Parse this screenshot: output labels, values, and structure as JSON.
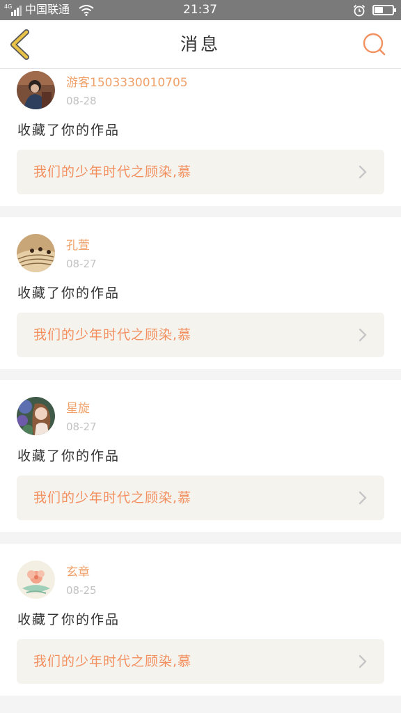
{
  "status_bar": {
    "network": "4G",
    "carrier": "中国联通",
    "time": "21:37",
    "icons": [
      "signal-icon",
      "wifi-icon",
      "alarm-icon",
      "battery-icon"
    ],
    "battery_level": 0.45
  },
  "header": {
    "title": "消息",
    "back_icon": "chevron-left-icon",
    "search_icon": "search-icon"
  },
  "colors": {
    "accent": "#f39060",
    "back_icon": "#e9c24a",
    "username": "#f0a068",
    "date": "#c2c2c2",
    "card_link_bg": "#f4f3ee",
    "page_bg": "#f4f4f4",
    "status_bar_bg": "#7a7a7a"
  },
  "messages": [
    {
      "username": "游客1503330010705",
      "date": "08-28",
      "action": "收藏了你的作品",
      "work_title": "我们的少年时代之顾染,慕",
      "link_icon": "chevron-right-icon"
    },
    {
      "username": "孔萱",
      "date": "08-27",
      "action": "收藏了你的作品",
      "work_title": "我们的少年时代之顾染,慕",
      "link_icon": "chevron-right-icon"
    },
    {
      "username": "星旋",
      "date": "08-27",
      "action": "收藏了你的作品",
      "work_title": "我们的少年时代之顾染,慕",
      "link_icon": "chevron-right-icon"
    },
    {
      "username": "玄章",
      "date": "08-25",
      "action": "收藏了你的作品",
      "work_title": "我们的少年时代之顾染,慕",
      "link_icon": "chevron-right-icon"
    }
  ]
}
